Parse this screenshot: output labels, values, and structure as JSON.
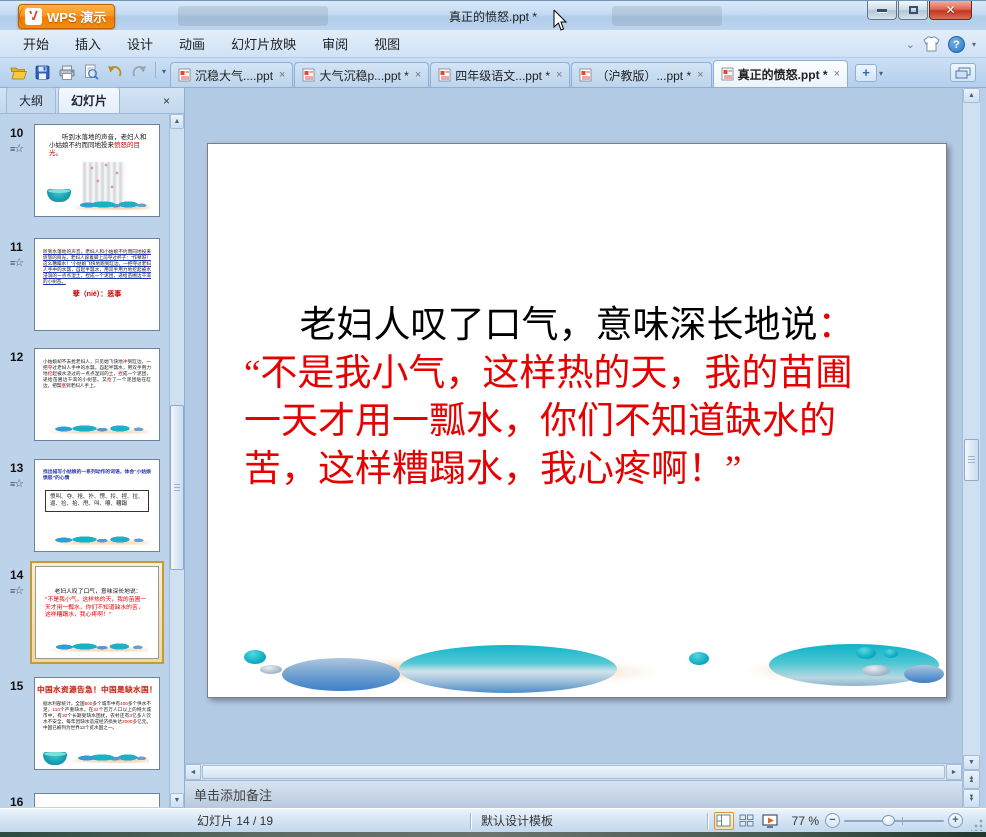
{
  "window": {
    "app_name": "WPS 演示",
    "title": "真正的愤怒.ppt *",
    "close_label": "×"
  },
  "menubar": {
    "items": [
      "开始",
      "插入",
      "设计",
      "动画",
      "幻灯片放映",
      "审阅",
      "视图"
    ]
  },
  "toolbar": {
    "icons": [
      "open-file",
      "save",
      "print",
      "print-preview",
      "undo",
      "redo",
      "toolbar-options"
    ]
  },
  "doc_tabs": {
    "tabs": [
      {
        "label": "沉稳大气....ppt",
        "close": "×",
        "active": false
      },
      {
        "label": "大气沉稳p...ppt *",
        "close": "×",
        "active": false
      },
      {
        "label": "四年级语文...ppt *",
        "close": "×",
        "active": false
      },
      {
        "label": "（沪教版）...ppt *",
        "close": "×",
        "active": false
      },
      {
        "label": "真正的愤怒.ppt *",
        "close": "×",
        "active": true
      }
    ],
    "new_tab_label": "+"
  },
  "sidebar": {
    "tabs": [
      {
        "label": "大纲",
        "active": false
      },
      {
        "label": "幻灯片",
        "active": true
      }
    ],
    "close_label": "×",
    "slides": [
      {
        "num": "10",
        "segments": [
          "听到水落地的声音，老妇人和小姑娘不约而同地投来",
          "愤怒的目光",
          "。"
        ]
      },
      {
        "num": "11",
        "body": "听到水落地的声音，老妇人和小姑娘不约而同地投来愤怒的目光。老妇人跺着脚上前夺过杯子：“作孽呀！这么糟蹋水！”小姑娘飞快地跑到缸边，一把夺过老妇人手中的水瓢，舀起半瓢水，用双手用力地挖起被水浸润的一点点湿土，捏成一个泥团，递给苗圃边干渴的小树苗。",
        "red_note": "孽（niè）：恶事"
      },
      {
        "num": "12",
        "segments": [
          "小姑娘却不去抢老妇人，只见她飞快地",
          "冲",
          "到缸边，一把",
          "夺",
          "过老妇人手中的水瓢，舀起半瓢水，用双手用力地",
          "挖",
          "起被水浇过的一点点湿润的土，",
          "捏",
          "成一个泥团，递给苗圃边干渴的小树苗。又",
          "抢",
          "了一个泥团贴在缸边，把瓢",
          "塞",
          "到老妇人手上。"
        ]
      },
      {
        "num": "13",
        "title": "找出描写小姑娘的一系列动作的词语，体会“小姑娘愤怒”的心情",
        "box": "愤叫、夺、抢、扑、愣、拎、捏、拉、逼、捡、拾、甩、叫、嚷、糟蹋"
      },
      {
        "num": "14",
        "black": "老妇人叹了口气，意味深长地说：",
        "red": "“不是我小气，这样热的天，我的苗圃一天才用一瓢水，你们不知道缺水的苦，这样糟蹋水，我心疼啊！”"
      },
      {
        "num": "15",
        "title": "中国水资源告急！中国是缺水国！",
        "segments": [
          "据水利部统计，全国",
          "600",
          "多个城市中有",
          "400",
          "多个供水不足，",
          "110",
          "个严重缺水。在",
          "32",
          "个百万人口以上的特大城市中，有",
          "30",
          "个长期受缺水困扰，农村还有",
          "3",
          "亿多人饮水不安全，每年因缺水造成经济损失达",
          "2000多",
          "亿元。中国已被列为世界13个贫水国之一。"
        ]
      },
      {
        "num": "16"
      }
    ]
  },
  "slide": {
    "title_segments": [
      "老妇人叹了口气，意味深长地说",
      "："
    ],
    "red_lines": [
      "“不是我小气，这样热的天，我的苗圃",
      "一天才用一瓢水，你们不知道缺水的",
      "苦，这样糟蹋水，我心疼啊！”"
    ]
  },
  "notes": {
    "placeholder": "单击添加备注"
  },
  "statusbar": {
    "slide_position": "幻灯片 14 / 19",
    "template_name": "默认设计模板",
    "zoom_level": "77 %"
  },
  "colors": {
    "accent_orange": "#ef7c00",
    "slide_text_red": "#e60000",
    "droplet_teal": "#12aec6",
    "droplet_blue": "#3b7ec9",
    "selected_thumb_border": "#c79a38"
  }
}
